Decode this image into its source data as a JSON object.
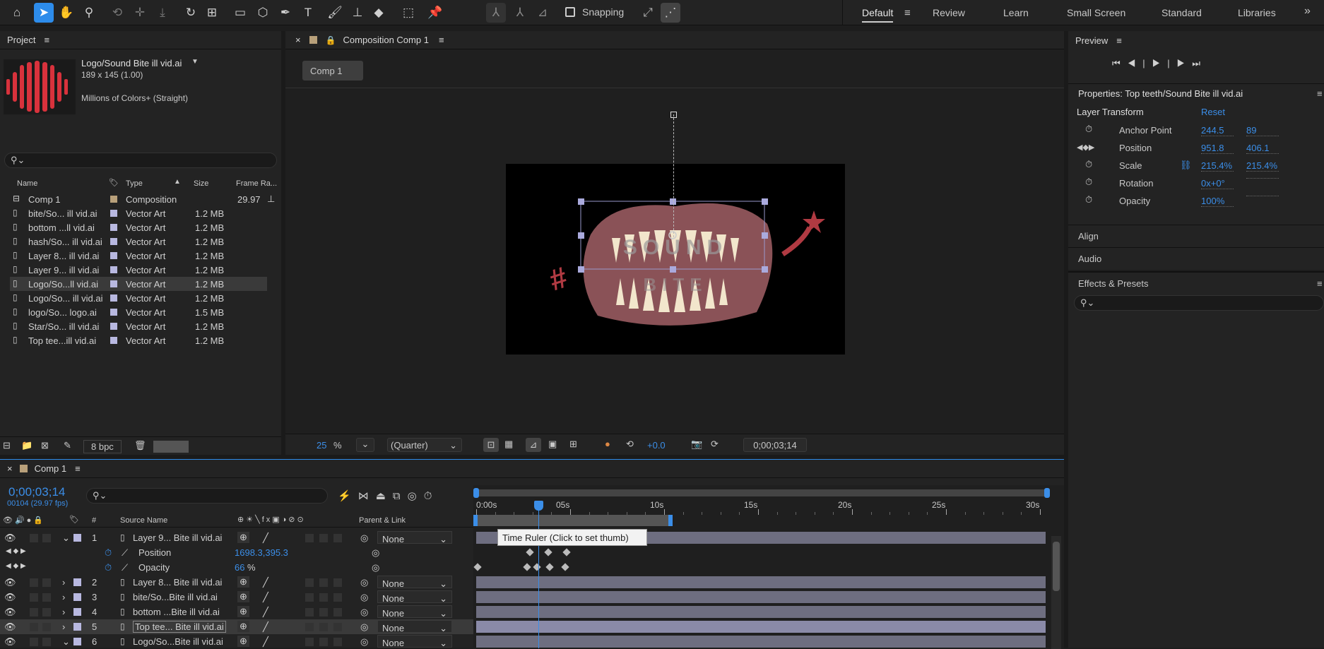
{
  "toolbar": {
    "snapping_label": "Snapping",
    "workspaces": [
      "Default",
      "Review",
      "Learn",
      "Small Screen",
      "Standard",
      "Libraries"
    ],
    "more": "»"
  },
  "project": {
    "title": "Project",
    "preview_name": "Logo/Sound Bite ill vid.ai",
    "preview_dims": "189 x 145 (1.00)",
    "preview_colors": "Millions of Colors+ (Straight)",
    "columns": [
      "Name",
      "Type",
      "Size",
      "Frame Ra..."
    ],
    "items": [
      {
        "name": "Comp 1",
        "type": "Composition",
        "size": "",
        "fps": "29.97",
        "kind": "comp"
      },
      {
        "name": "bite/So... ill vid.ai",
        "type": "Vector Art",
        "size": "1.2 MB",
        "fps": "",
        "kind": "file"
      },
      {
        "name": "bottom ...ll vid.ai",
        "type": "Vector Art",
        "size": "1.2 MB",
        "fps": "",
        "kind": "file"
      },
      {
        "name": "hash/So... ill vid.ai",
        "type": "Vector Art",
        "size": "1.2 MB",
        "fps": "",
        "kind": "file"
      },
      {
        "name": "Layer 8... ill vid.ai",
        "type": "Vector Art",
        "size": "1.2 MB",
        "fps": "",
        "kind": "file"
      },
      {
        "name": "Layer 9... ill vid.ai",
        "type": "Vector Art",
        "size": "1.2 MB",
        "fps": "",
        "kind": "file"
      },
      {
        "name": "Logo/So...ll vid.ai",
        "type": "Vector Art",
        "size": "1.2 MB",
        "fps": "",
        "kind": "file"
      },
      {
        "name": "Logo/So... ill vid.ai",
        "type": "Vector Art",
        "size": "1.2 MB",
        "fps": "",
        "kind": "file"
      },
      {
        "name": "logo/So... logo.ai",
        "type": "Vector Art",
        "size": "1.5 MB",
        "fps": "",
        "kind": "file"
      },
      {
        "name": "Star/So... ill vid.ai",
        "type": "Vector Art",
        "size": "1.2 MB",
        "fps": "",
        "kind": "file"
      },
      {
        "name": "Top tee...ill vid.ai",
        "type": "Vector Art",
        "size": "1.2 MB",
        "fps": "",
        "kind": "file"
      }
    ],
    "bpc": "8 bpc"
  },
  "composition": {
    "tab_title": "Composition Comp 1",
    "comp_button": "Comp 1",
    "zoom_value": "25",
    "zoom_unit": "%",
    "resolution": "(Quarter)",
    "exposure": "+0.0",
    "timecode": "0;00;03;14",
    "canvas_text": "SOUND BITE"
  },
  "preview": {
    "title": "Preview"
  },
  "properties": {
    "title": "Properties: Top teeth/Sound Bite ill vid.ai",
    "section": "Layer Transform",
    "reset": "Reset",
    "rows": [
      {
        "label": "Anchor Point",
        "v1": "244.5",
        "v2": "89"
      },
      {
        "label": "Position",
        "v1": "951.8",
        "v2": "406.1"
      },
      {
        "label": "Scale",
        "v1": "215.4%",
        "v2": "215.4%"
      },
      {
        "label": "Rotation",
        "v1": "0x+0°",
        "v2": ""
      },
      {
        "label": "Opacity",
        "v1": "100%",
        "v2": ""
      }
    ],
    "align": "Align",
    "audio": "Audio",
    "effects": "Effects & Presets"
  },
  "timeline": {
    "tab_title": "Comp 1",
    "timecode": "0;00;03;14",
    "frame_info": "00104 (29.97 fps)",
    "col_source": "Source Name",
    "col_parent": "Parent & Link",
    "col_num": "#",
    "ruler_labels": [
      "0:00s",
      "05s",
      "10s",
      "15s",
      "20s",
      "25s",
      "30s"
    ],
    "tooltip": "Time Ruler (Click to set thumb)",
    "layers": [
      {
        "num": "1",
        "name": "Layer 9... Bite ill vid.ai",
        "parent": "None"
      },
      {
        "num": "2",
        "name": "Layer 8... Bite ill vid.ai",
        "parent": "None"
      },
      {
        "num": "3",
        "name": "bite/So...Bite ill vid.ai",
        "parent": "None"
      },
      {
        "num": "4",
        "name": "bottom ...Bite ill vid.ai",
        "parent": "None"
      },
      {
        "num": "5",
        "name": "Top tee... Bite ill vid.ai",
        "parent": "None"
      },
      {
        "num": "6",
        "name": "Logo/So...Bite ill vid.ai",
        "parent": "None"
      }
    ],
    "props": [
      {
        "label": "Position",
        "value": "1698.3,395.3"
      },
      {
        "label": "Opacity",
        "value": "66",
        "unit": "%"
      }
    ]
  }
}
